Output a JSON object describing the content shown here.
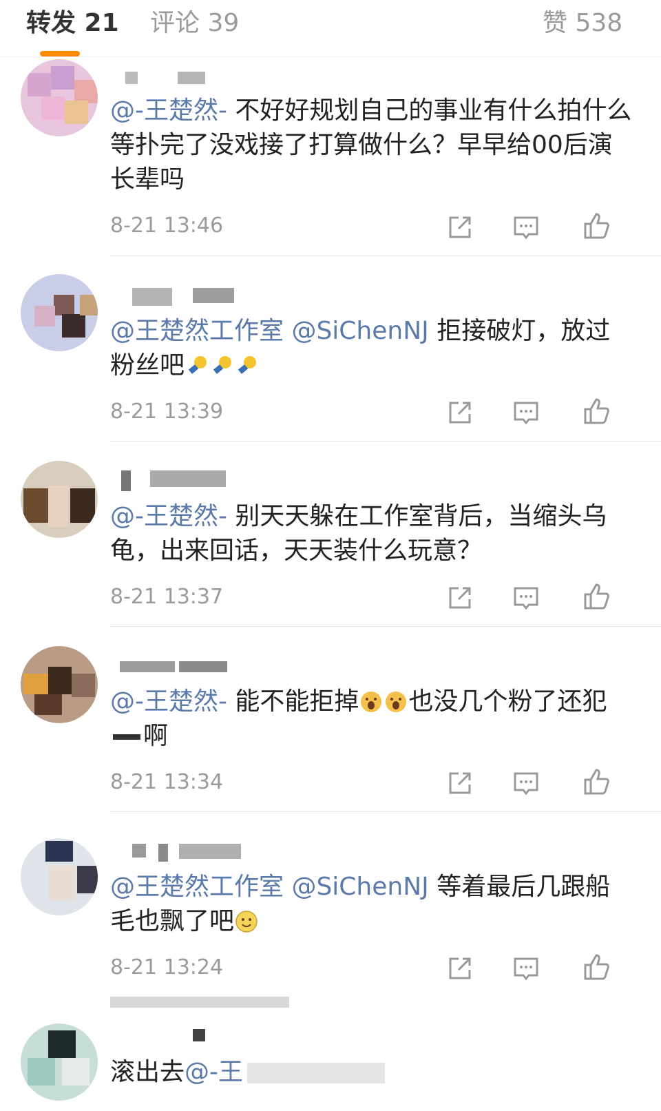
{
  "tabs": {
    "repost": "转发 21",
    "comment": "评论 39",
    "like": "赞 538"
  },
  "comments": [
    {
      "mention": "@-王楚然-",
      "text": " 不好好规划自己的事业有什么拍什么等扑完了没戏接了打算做什么？早早给00后演长辈吗",
      "time": "8-21 13:46"
    },
    {
      "mention": "@王楚然工作室 @SiChenNJ",
      "text": " 拒接破灯，放过粉丝吧",
      "time": "8-21 13:39"
    },
    {
      "mention": "@-王楚然-",
      "text": " 别天天躲在工作室背后，当缩头乌龟，出来回话，天天装什么玩意？",
      "time": "8-21 13:37"
    },
    {
      "mention": "@-王楚然-",
      "text": " 能不能拒掉",
      "text2": "也没几个粉了还犯",
      "text3": "啊",
      "time": "8-21 13:34"
    },
    {
      "mention": "@王楚然工作室 @SiChenNJ",
      "text": " 等着最后几跟船毛也飘了吧",
      "time": "8-21 13:24"
    },
    {
      "text": "滚出去",
      "mention": "@-王",
      "time": ""
    }
  ],
  "colors": {
    "accent": "#ff8a00",
    "mention": "#5b7aa9",
    "meta": "#9a9a9a"
  },
  "icons": [
    "repost-icon",
    "comment-icon",
    "like-icon",
    "bulb-emoji",
    "scream-emoji",
    "smile-emoji"
  ]
}
